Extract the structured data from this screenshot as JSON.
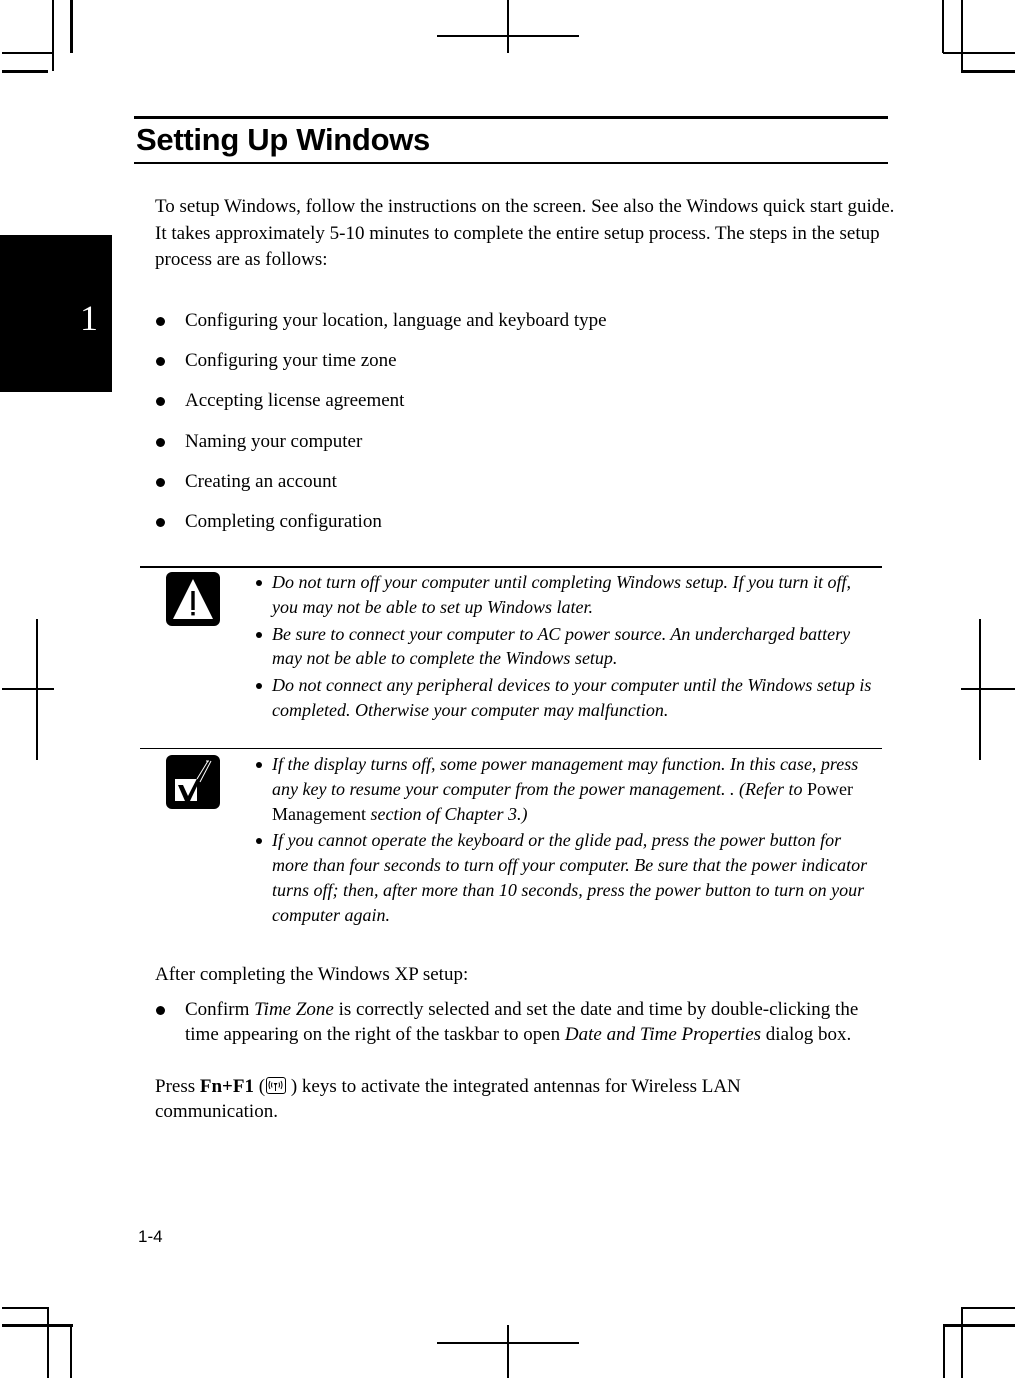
{
  "chapter_tab": {
    "number": "1"
  },
  "section": {
    "title": "Setting Up Windows",
    "intro": "To setup Windows, follow the instructions on the screen.  See also the Windows quick start guide.  It takes approximately 5-10 minutes to complete the entire setup process. The steps in the setup process are as follows:"
  },
  "steps": [
    "Configuring your location, language and keyboard type",
    "Configuring your time zone",
    "Accepting license agreement",
    "Naming your computer",
    "Creating an account",
    "Completing configuration"
  ],
  "caution": {
    "icon": "warning-triangle-icon",
    "items": [
      "Do not turn off your computer until completing Windows setup. If you turn it off, you may not be able to set up Windows later.",
      "Be sure to connect your computer to AC power source. An undercharged battery may not be able to complete the Windows setup.",
      "Do not connect any peripheral devices to your computer until the Windows setup is completed. Otherwise your computer may malfunction."
    ]
  },
  "note": {
    "icon": "checkmark-icon",
    "item1_pre": "If the display turns off, some power management may function. In this case, press any key to resume your computer from the power management. . (Refer to ",
    "item1_ref": "Power Management",
    "item1_post": " section of Chapter 3.)",
    "item2": "If you cannot operate the keyboard or the glide pad, press the power button for more than four seconds to turn off your computer. Be sure that the power indicator turns off; then, after more than 10 seconds, press the power button to turn on your computer again."
  },
  "after_setup": {
    "heading": "After completing the Windows XP setup:",
    "bullet_pre": "Confirm ",
    "bullet_em1": "Time Zone",
    "bullet_mid": " is correctly selected and set the date and time by double-clicking the time appearing on the right of the taskbar to open ",
    "bullet_em2": "Date and Time Properties",
    "bullet_post": " dialog box.",
    "press_pre": "Press ",
    "press_keys": "Fn+F1",
    "press_icon": "wireless-antenna-icon",
    "press_post": " ) keys to activate the integrated antennas for Wireless LAN communication."
  },
  "footer": {
    "page_number": "1-4"
  }
}
